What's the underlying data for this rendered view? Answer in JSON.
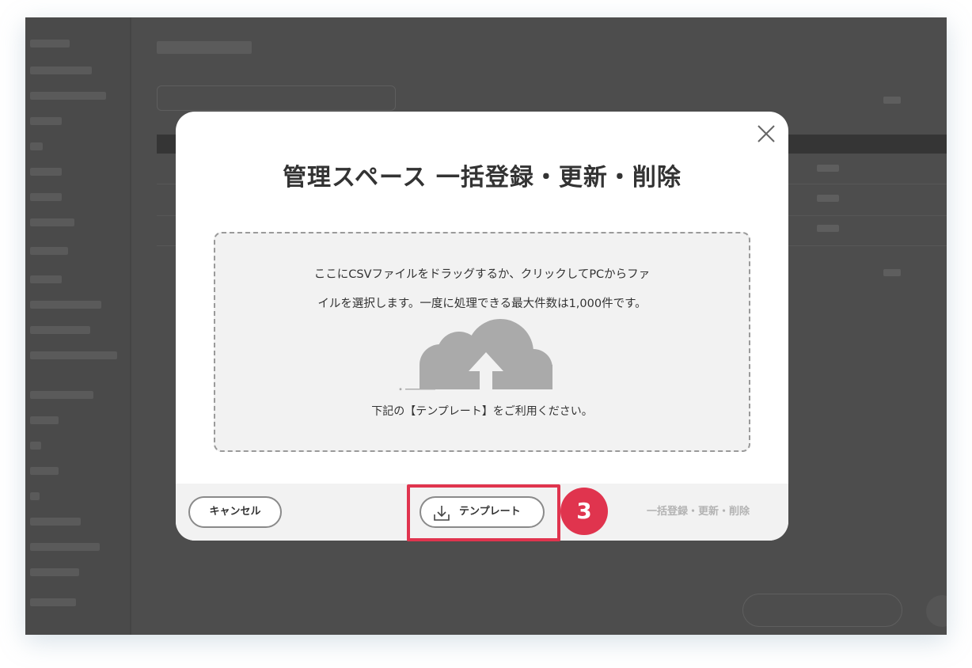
{
  "modal": {
    "title": "管理スペース 一括登録・更新・削除",
    "dropzone": {
      "instruction_line1": "ここにCSVファイルをドラッグするか、クリックしてPCからファ",
      "instruction_line2": "イルを選択します。一度に処理できる最大件数は1,000件です。",
      "icon": "cloud-upload-icon",
      "template_note": "下記の【テンプレート】をご利用ください。"
    },
    "footer": {
      "cancel_label": "キャンセル",
      "template_label": "テンプレート",
      "template_icon": "download-icon",
      "bulk_label": "一括登録・更新・削除"
    },
    "close_icon": "close-icon"
  },
  "annotation": {
    "step_number": "3",
    "color": "#e0344e"
  }
}
